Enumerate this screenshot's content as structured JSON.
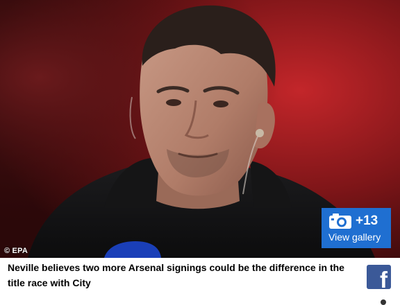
{
  "photo": {
    "credit": "© EPA",
    "subject_description_icon": "portrait-photo"
  },
  "gallery": {
    "count": "+13",
    "label": "View gallery",
    "icon": "camera-icon",
    "color": "#1f6fd1"
  },
  "caption": {
    "text": "Neville believes two more Arsenal signings could be the difference in the title race with City"
  },
  "share": {
    "facebook_glyph": "f",
    "facebook_icon": "facebook-icon",
    "facebook_color": "#3b5998"
  }
}
